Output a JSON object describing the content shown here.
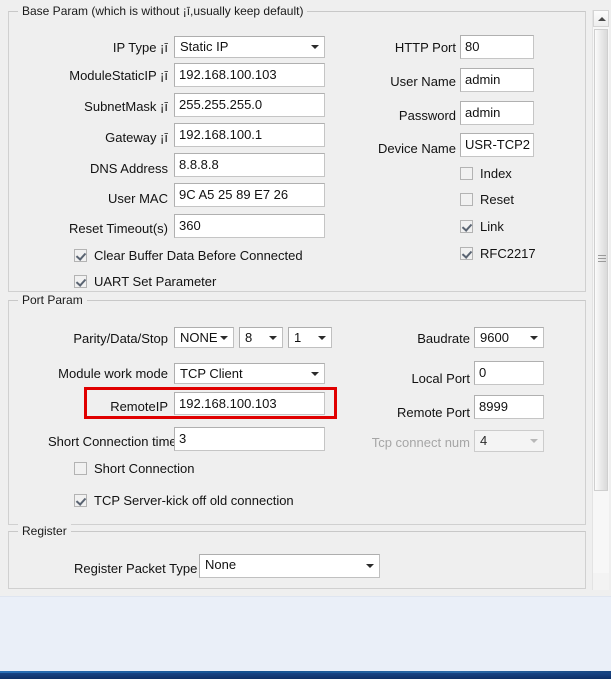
{
  "base_param": {
    "title": "Base Param (which is without ¡ī,usually keep default)",
    "fields": {
      "ip_type_label": "IP Type ¡ī",
      "ip_type_value": "Static IP",
      "module_static_ip_label": "ModuleStaticIP ¡ī",
      "module_static_ip_value": "192.168.100.103",
      "subnet_mask_label": "SubnetMask ¡ī",
      "subnet_mask_value": "255.255.255.0",
      "gateway_label": "Gateway ¡ī",
      "gateway_value": "192.168.100.1",
      "dns_address_label": "DNS Address",
      "dns_address_value": "8.8.8.8",
      "user_mac_label": "User MAC",
      "user_mac_value": "9C A5 25 89 E7 26",
      "reset_timeout_label": "Reset Timeout(s)",
      "reset_timeout_value": "360",
      "http_port_label": "HTTP Port",
      "http_port_value": "80",
      "user_name_label": "User Name",
      "user_name_value": "admin",
      "password_label": "Password",
      "password_value": "admin",
      "device_name_label": "Device Name",
      "device_name_value": "USR-TCP2"
    },
    "checkboxes": {
      "clear_buffer_label": "Clear Buffer Data Before Connected",
      "clear_buffer_checked": true,
      "uart_set_param_label": "UART Set Parameter",
      "uart_set_param_checked": true,
      "index_label": "Index",
      "index_checked": false,
      "reset_label": "Reset",
      "reset_checked": false,
      "link_label": "Link",
      "link_checked": true,
      "rfc2217_label": "RFC2217",
      "rfc2217_checked": true
    }
  },
  "port_param": {
    "title": "Port Param",
    "fields": {
      "parity_data_stop_label": "Parity/Data/Stop",
      "parity_value": "NONE",
      "data_value": "8",
      "stop_value": "1",
      "module_work_mode_label": "Module work mode",
      "module_work_mode_value": "TCP Client",
      "remote_ip_label": "RemoteIP",
      "remote_ip_value": "192.168.100.103",
      "short_connection_time_label": "Short Connection time",
      "short_connection_time_value": "3",
      "baudrate_label": "Baudrate",
      "baudrate_value": "9600",
      "local_port_label": "Local Port",
      "local_port_value": "0",
      "remote_port_label": "Remote Port",
      "remote_port_value": "8999",
      "tcp_connect_num_label": "Tcp connect num",
      "tcp_connect_num_value": "4"
    },
    "checkboxes": {
      "short_connection_label": "Short Connection",
      "short_connection_checked": false,
      "tcp_kick_off_label": "TCP Server-kick off old connection",
      "tcp_kick_off_checked": true
    }
  },
  "register": {
    "title": "Register",
    "fields": {
      "register_packet_type_label": "Register Packet Type",
      "register_packet_type_value": "None"
    }
  },
  "colors": {
    "highlight": "#e00000",
    "panel_bg": "#efefef",
    "dialog_bg": "#eaeff8",
    "taskbar": "#0e2f66"
  }
}
